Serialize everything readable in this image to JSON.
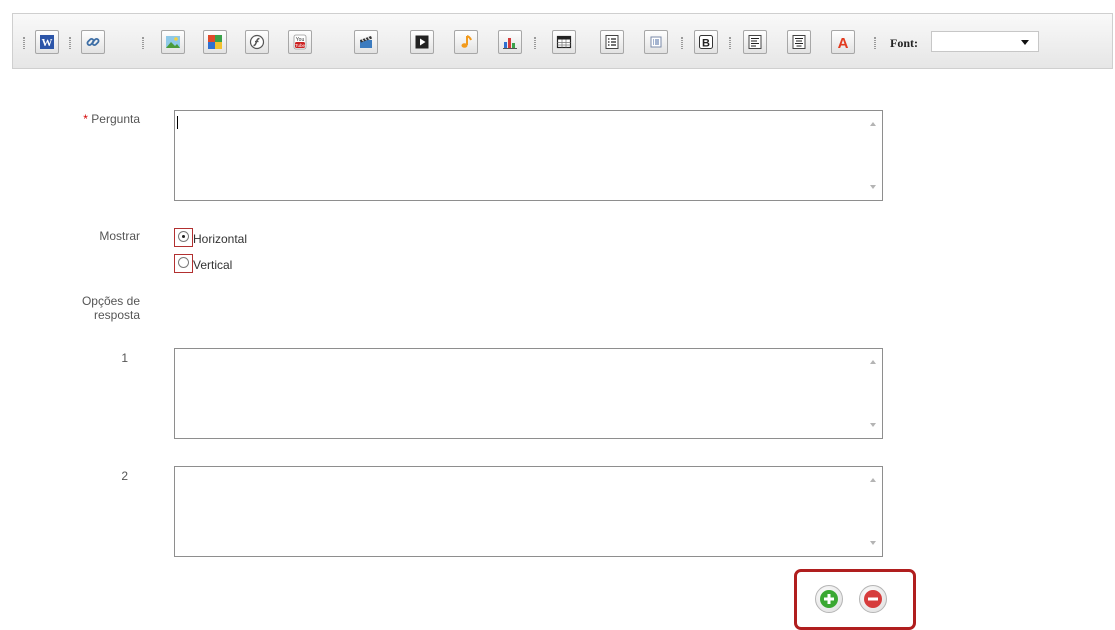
{
  "toolbar": {
    "buttons": [
      {
        "name": "word-icon"
      },
      {
        "name": "link-icon"
      },
      {
        "name": "image-icon"
      },
      {
        "name": "gallery-icon"
      },
      {
        "name": "flash-icon"
      },
      {
        "name": "youtube-icon"
      },
      {
        "name": "video-clapper-icon"
      },
      {
        "name": "media-play-icon"
      },
      {
        "name": "audio-note-icon"
      },
      {
        "name": "chart-icon"
      },
      {
        "name": "table-icon"
      },
      {
        "name": "list-icon"
      },
      {
        "name": "small-list-icon"
      },
      {
        "name": "bold-icon"
      },
      {
        "name": "align-left-icon"
      },
      {
        "name": "align-center-icon"
      },
      {
        "name": "font-color-icon"
      }
    ],
    "font_label": "Font:",
    "font_value": ""
  },
  "form": {
    "required_mark": "*",
    "question_label": "Pergunta",
    "question_value": "",
    "show_label": "Mostrar",
    "show_options": [
      {
        "label": "Horizontal",
        "checked": true
      },
      {
        "label": "Vertical",
        "checked": false
      }
    ],
    "answers_label_line1": "Opções de",
    "answers_label_line2": "resposta",
    "answers": [
      {
        "number": "1",
        "value": ""
      },
      {
        "number": "2",
        "value": ""
      }
    ]
  },
  "colors": {
    "required": "#d40000",
    "highlight_border": "#b01e1e",
    "add_button": "#3aa832",
    "remove_button": "#d63c3c"
  }
}
